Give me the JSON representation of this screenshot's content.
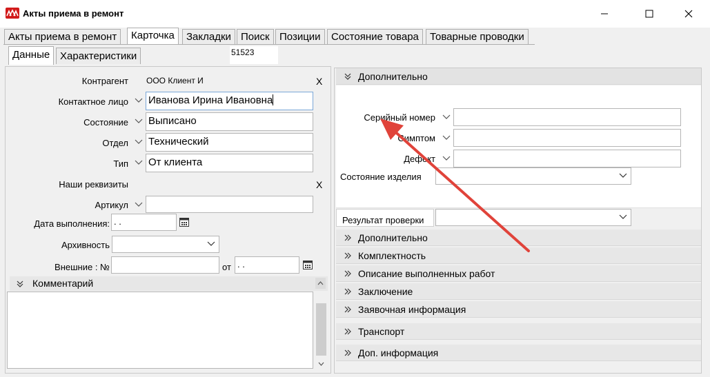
{
  "window": {
    "title": "Акты приема в ремонт",
    "icon": "app-logo-icon",
    "controls": [
      "minimize-icon",
      "maximize-icon",
      "close-icon"
    ]
  },
  "tabs": [
    {
      "label": "Акты приема в ремонт"
    },
    {
      "label": "Карточка",
      "active": true
    },
    {
      "label": "Закладки"
    },
    {
      "label": "Поиск"
    },
    {
      "label": "Позиции"
    },
    {
      "label": "Состояние товара"
    },
    {
      "label": "Товарные проводки"
    }
  ],
  "subtabs": [
    {
      "label": "Данные",
      "active": true
    },
    {
      "label": "Характеристики"
    }
  ],
  "record_number": "51523",
  "form": {
    "kontragent": {
      "label": "Контрагент",
      "value": "ООО Клиент И",
      "clear": "X"
    },
    "contact": {
      "label": "Контактное лицо",
      "value": "Иванова Ирина Ивановна"
    },
    "state": {
      "label": "Состояние",
      "value": "Выписано"
    },
    "department": {
      "label": "Отдел",
      "value": "Технический"
    },
    "type": {
      "label": "Тип",
      "value": "От клиента"
    },
    "requisites": {
      "label": "Наши реквизиты",
      "clear": "X"
    },
    "article": {
      "label": "Артикул",
      "value": ""
    },
    "due_date": {
      "label": "Дата выполнения:",
      "value": " .  ."
    },
    "archive": {
      "label": "Архивность",
      "value": ""
    },
    "external": {
      "label": "Внешние : №",
      "value": "",
      "from_label": "от",
      "date_value": " .  ."
    }
  },
  "comment": {
    "label": "Комментарий",
    "value": ""
  },
  "right": {
    "top_group": "Дополнительно",
    "serial": {
      "label": "Серийный номер",
      "value": ""
    },
    "symptom": {
      "label": "Симптом",
      "value": ""
    },
    "defect": {
      "label": "Дефект",
      "value": ""
    },
    "product_state": {
      "label": "Состояние изделия",
      "value": ""
    },
    "check_result": {
      "label": "Результат проверки",
      "value": ""
    },
    "groups": [
      {
        "label": "Дополнительно"
      },
      {
        "label": "Комплектность"
      },
      {
        "label": "Описание выполненных работ"
      },
      {
        "label": "Заключение"
      },
      {
        "label": "Заявочная информация"
      },
      {
        "label": "Транспорт"
      },
      {
        "label": "Доп. информация"
      }
    ]
  },
  "colors": {
    "annotation_arrow": "#e0433a",
    "app_icon": "#d21a1a",
    "active_tab": "#ffffff"
  }
}
